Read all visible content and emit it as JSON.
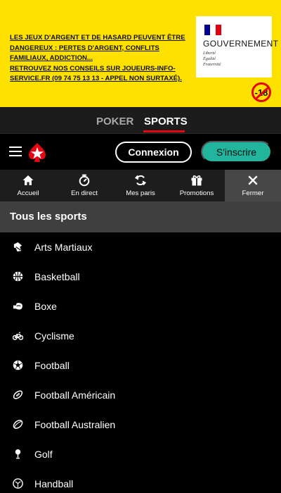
{
  "banner": {
    "warning_lines": [
      "LES JEUX D'ARGENT ET DE HASARD PEUVENT ÊTRE",
      "DANGEREUX : PERTES D'ARGENT, CONFLITS",
      "FAMILIAUX, ADDICTION...",
      "RETROUVEZ NOS CONSEILS SUR JOUEURS-INFO-",
      "SERVICE.FR (09 74 75 13 13 - APPEL NON SURTAXÉ)."
    ],
    "gov_title": "GOUVERNEMENT",
    "gov_motto": [
      "Liberté",
      "Égalité",
      "Fraternité"
    ],
    "age_limit": "-18"
  },
  "brand_tabs": {
    "poker": "POKER",
    "sports": "SPORTS",
    "active": "SPORTS"
  },
  "header": {
    "login_label": "Connexion",
    "signup_label": "S'inscrire"
  },
  "nav": {
    "items": [
      {
        "label": "Accueil",
        "icon": "home-icon"
      },
      {
        "label": "En direct",
        "icon": "stopwatch-icon"
      },
      {
        "label": "Mes paris",
        "icon": "refresh-arrows-icon"
      },
      {
        "label": "Promotions",
        "icon": "gift-icon"
      },
      {
        "label": "Fermer",
        "icon": "close-icon"
      }
    ]
  },
  "sports": {
    "title": "Tous les sports",
    "items": [
      {
        "label": "Arts Martiaux",
        "icon": "martial-arts-icon"
      },
      {
        "label": "Basketball",
        "icon": "basketball-icon"
      },
      {
        "label": "Boxe",
        "icon": "boxing-glove-icon"
      },
      {
        "label": "Cyclisme",
        "icon": "bicycle-icon"
      },
      {
        "label": "Football",
        "icon": "soccer-ball-icon"
      },
      {
        "label": "Football Américain",
        "icon": "american-football-icon"
      },
      {
        "label": "Football Australien",
        "icon": "australian-football-icon"
      },
      {
        "label": "Golf",
        "icon": "golf-icon"
      },
      {
        "label": "Handball",
        "icon": "handball-icon"
      }
    ]
  },
  "colors": {
    "banner_yellow": "#ffe100",
    "brand_red": "#e30613",
    "signup_teal": "#20b59c",
    "nav_background": "#1d1d1d",
    "title_bar": "#3f3f3f"
  }
}
